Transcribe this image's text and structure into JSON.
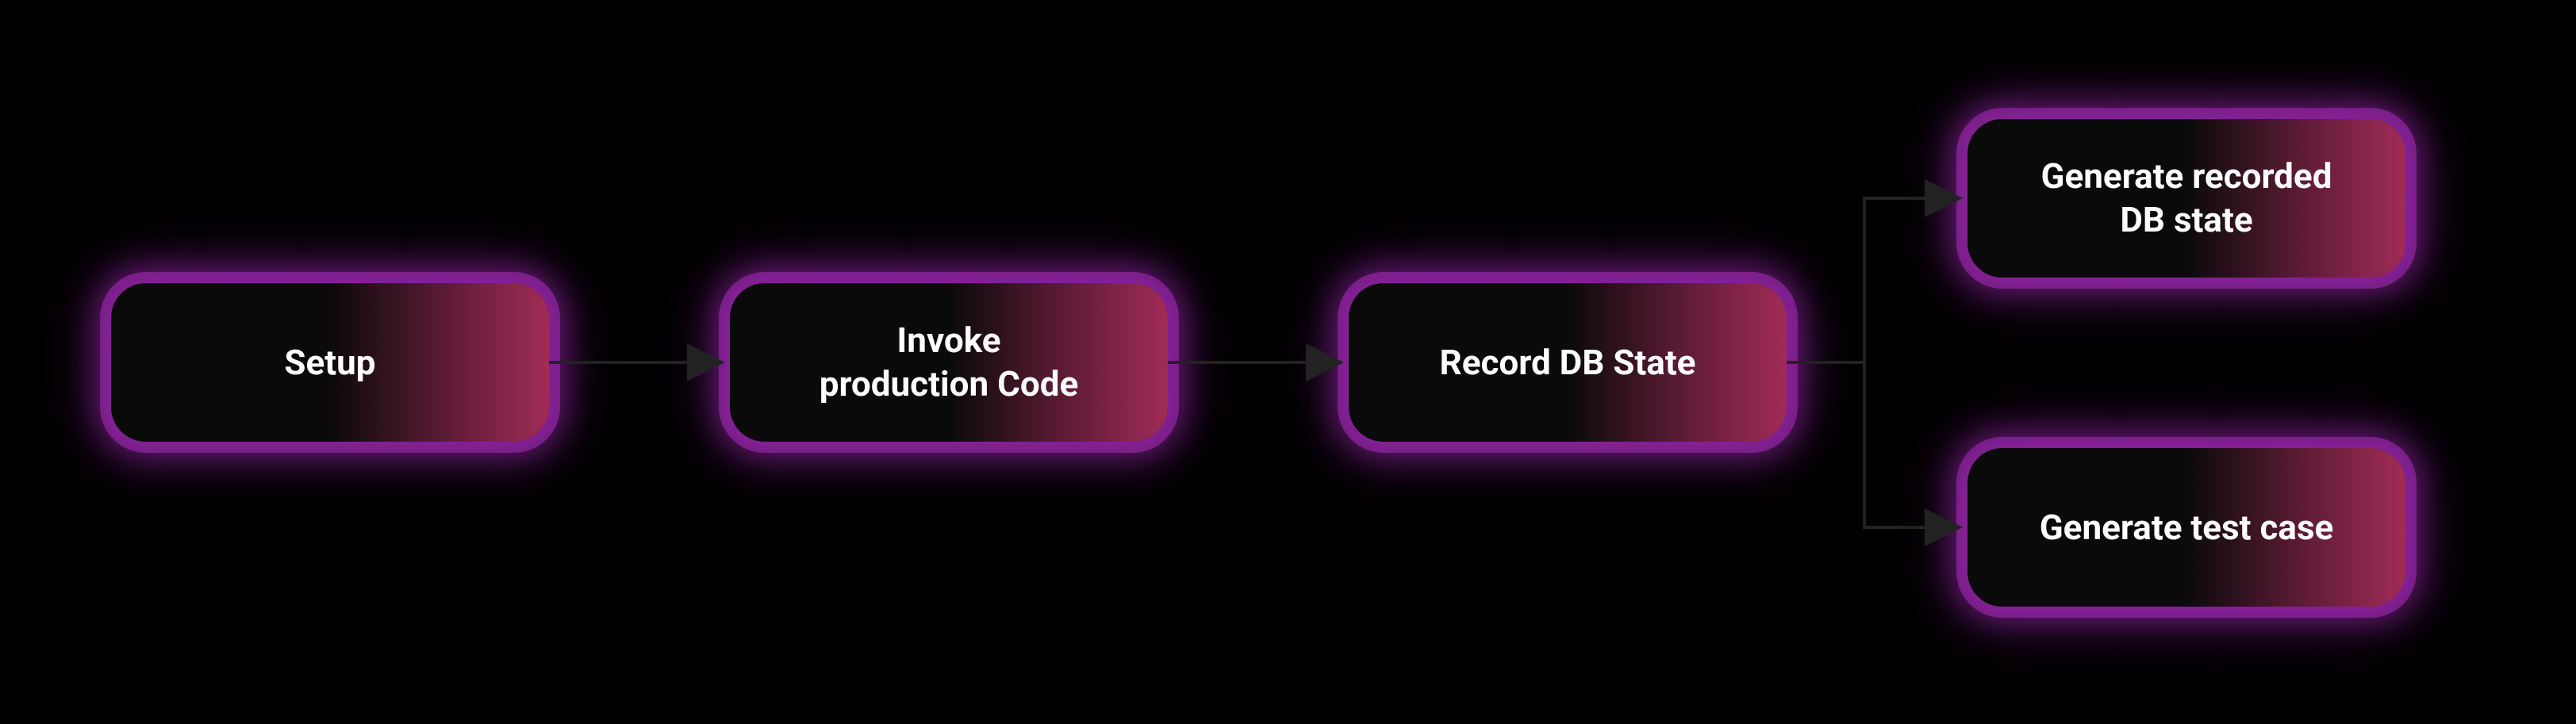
{
  "nodes": {
    "setup": {
      "label": "Setup"
    },
    "invoke": {
      "label": "Invoke\nproduction Code"
    },
    "record": {
      "label": "Record DB State"
    },
    "generate_db": {
      "label": "Generate recorded\nDB state"
    },
    "generate_test": {
      "label": "Generate test case"
    }
  }
}
